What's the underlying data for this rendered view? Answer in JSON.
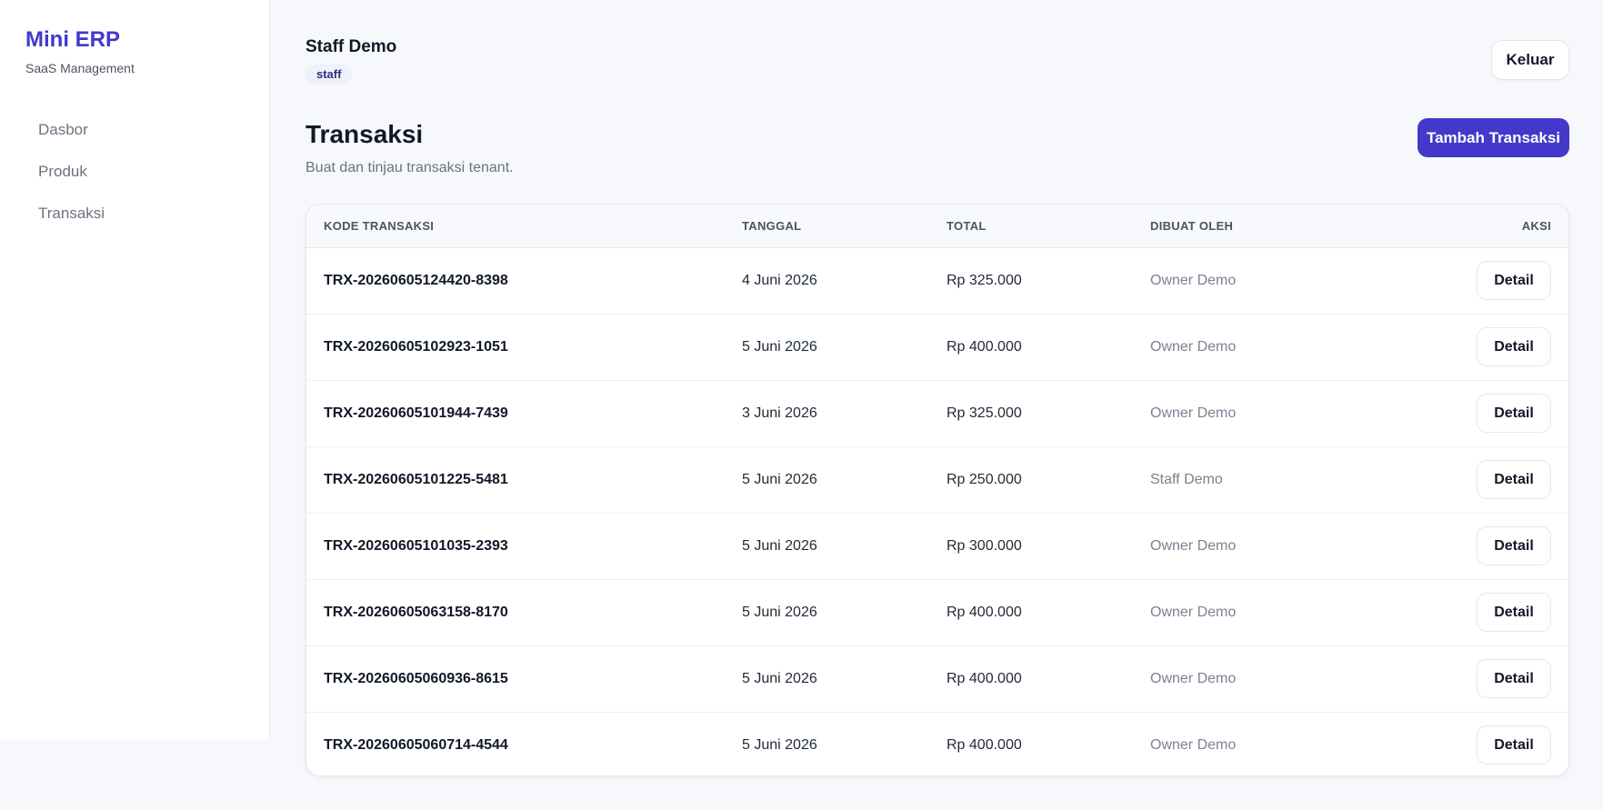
{
  "sidebar": {
    "brand": "Mini ERP",
    "brand_sub": "SaaS Management",
    "items": [
      {
        "label": "Dasbor"
      },
      {
        "label": "Produk"
      },
      {
        "label": "Transaksi"
      }
    ]
  },
  "header": {
    "user_name": "Staff Demo",
    "role": "staff",
    "logout_label": "Keluar"
  },
  "page": {
    "title": "Transaksi",
    "subtitle": "Buat dan tinjau transaksi tenant.",
    "add_label": "Tambah Transaksi"
  },
  "table": {
    "headers": {
      "code": "KODE TRANSAKSI",
      "date": "TANGGAL",
      "total": "TOTAL",
      "by": "DIBUAT OLEH",
      "action": "AKSI"
    },
    "rows": [
      {
        "code": "TRX-20260605124420-8398",
        "date": "4 Juni 2026",
        "total": "Rp 325.000",
        "by": "Owner Demo",
        "action": "Detail"
      },
      {
        "code": "TRX-20260605102923-1051",
        "date": "5 Juni 2026",
        "total": "Rp 400.000",
        "by": "Owner Demo",
        "action": "Detail"
      },
      {
        "code": "TRX-20260605101944-7439",
        "date": "3 Juni 2026",
        "total": "Rp 325.000",
        "by": "Owner Demo",
        "action": "Detail"
      },
      {
        "code": "TRX-20260605101225-5481",
        "date": "5 Juni 2026",
        "total": "Rp 250.000",
        "by": "Staff Demo",
        "action": "Detail"
      },
      {
        "code": "TRX-20260605101035-2393",
        "date": "5 Juni 2026",
        "total": "Rp 300.000",
        "by": "Owner Demo",
        "action": "Detail"
      },
      {
        "code": "TRX-20260605063158-8170",
        "date": "5 Juni 2026",
        "total": "Rp 400.000",
        "by": "Owner Demo",
        "action": "Detail"
      },
      {
        "code": "TRX-20260605060936-8615",
        "date": "5 Juni 2026",
        "total": "Rp 400.000",
        "by": "Owner Demo",
        "action": "Detail"
      },
      {
        "code": "TRX-20260605060714-4544",
        "date": "5 Juni 2026",
        "total": "Rp 400.000",
        "by": "Owner Demo",
        "action": "Detail"
      }
    ]
  },
  "colors": {
    "accent": "#4338ca",
    "background": "#f7f8fb",
    "muted_text": "#6b7280"
  }
}
